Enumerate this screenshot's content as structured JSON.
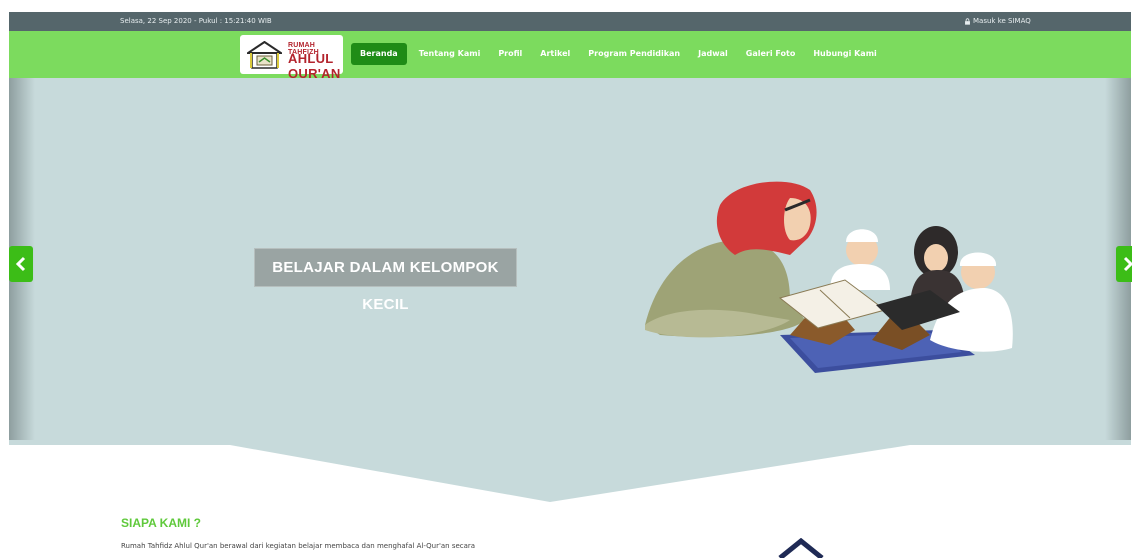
{
  "topbar": {
    "datetime": "Selasa, 22 Sep 2020 - Pukul : 15:21:40 WIB",
    "login_label": "Masuk ke SIMAQ",
    "login_icon": "lock-icon"
  },
  "logo": {
    "line1": "RUMAH TAHFIZH",
    "line2": "AHLUL QUR'AN"
  },
  "nav": {
    "items": [
      {
        "label": "Beranda",
        "active": true
      },
      {
        "label": "Tentang Kami"
      },
      {
        "label": "Profil"
      },
      {
        "label": "Artikel"
      },
      {
        "label": "Program Pendidikan"
      },
      {
        "label": "Jadwal"
      },
      {
        "label": "Galeri Foto"
      },
      {
        "label": "Hubungi Kami"
      }
    ]
  },
  "slider": {
    "caption": "BELAJAR DALAM KELOMPOK KECIL",
    "prev_icon": "chevron-left-icon",
    "next_icon": "chevron-right-icon"
  },
  "about": {
    "title": "SIAPA KAMI ?",
    "text": "Rumah Tahfidz Ahlul Qur'an berawal dari kegiatan belajar membaca dan menghafal Al-Qur'an secara"
  },
  "colors": {
    "topbar": "#55666b",
    "nav": "#7cdb5e",
    "nav_active": "#1f8c16",
    "hero_bg": "#c7dadb",
    "arrow": "#3cbd17",
    "accent_title": "#5fc93b",
    "brand_red": "#b3242d"
  }
}
